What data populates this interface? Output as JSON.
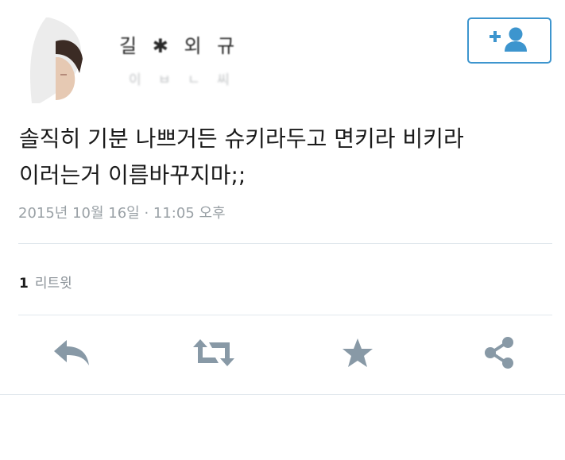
{
  "tweet": {
    "author": {
      "display_name": "길 ✱ 외 규",
      "handle": "이 ㅂ ㄴ 씨"
    },
    "text": "솔직히 기분 나쁘거든 슈키라두고 면키라 비키라\n이러는거 이름바꾸지마;;",
    "timestamp": "2015년 10월 16일 · 11:05 오후",
    "stats": {
      "retweet_count": "1",
      "retweet_label": "리트윗"
    }
  },
  "icons": {
    "follow": "add-user-icon",
    "reply": "reply-arrow-icon",
    "retweet": "retweet-icon",
    "favorite": "star-icon",
    "share": "share-icon"
  },
  "colors": {
    "accent": "#3d95ce",
    "action_icon": "#8899a6",
    "timestamp": "#9aa1a6",
    "divider": "#e1e8ed"
  }
}
